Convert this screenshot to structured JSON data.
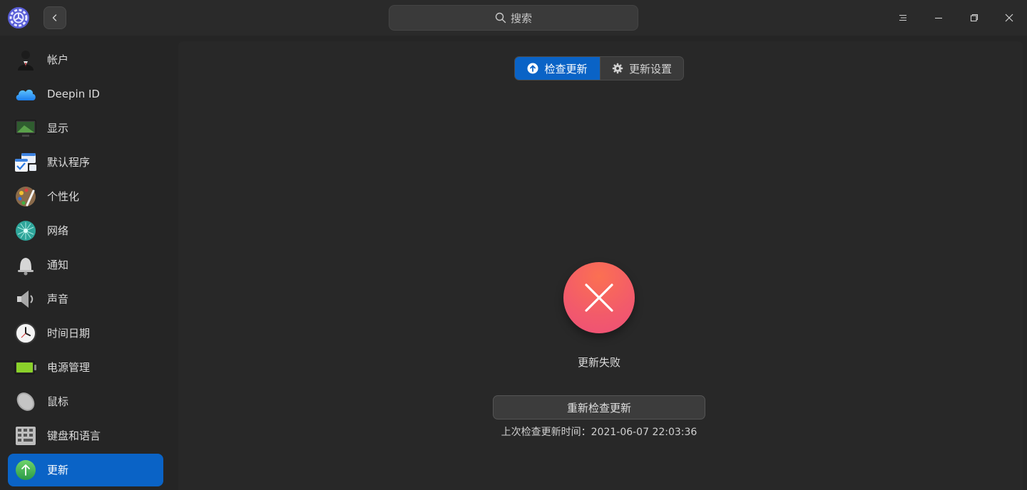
{
  "titlebar": {
    "search_placeholder": "搜索"
  },
  "sidebar": {
    "items": [
      {
        "label": "帐户",
        "icon": "account-icon"
      },
      {
        "label": "Deepin ID",
        "icon": "cloud-icon"
      },
      {
        "label": "显示",
        "icon": "display-icon"
      },
      {
        "label": "默认程序",
        "icon": "default-apps-icon"
      },
      {
        "label": "个性化",
        "icon": "personalization-icon"
      },
      {
        "label": "网络",
        "icon": "network-icon"
      },
      {
        "label": "通知",
        "icon": "bell-icon"
      },
      {
        "label": "声音",
        "icon": "speaker-icon"
      },
      {
        "label": "时间日期",
        "icon": "clock-icon"
      },
      {
        "label": "电源管理",
        "icon": "battery-icon"
      },
      {
        "label": "鼠标",
        "icon": "mouse-icon"
      },
      {
        "label": "键盘和语言",
        "icon": "keyboard-icon"
      },
      {
        "label": "更新",
        "icon": "update-icon",
        "active": true
      }
    ]
  },
  "main": {
    "tabs": [
      {
        "label": "检查更新",
        "icon": "upload-icon",
        "active": true
      },
      {
        "label": "更新设置",
        "icon": "gear-icon",
        "active": false
      }
    ],
    "status_text": "更新失败",
    "retry_label": "重新检查更新",
    "last_check_label": "上次检查更新时间：2021-06-07 22:03:36"
  },
  "colors": {
    "accent": "#0a63c6",
    "error": "#f25a6b",
    "background": "#252525"
  }
}
